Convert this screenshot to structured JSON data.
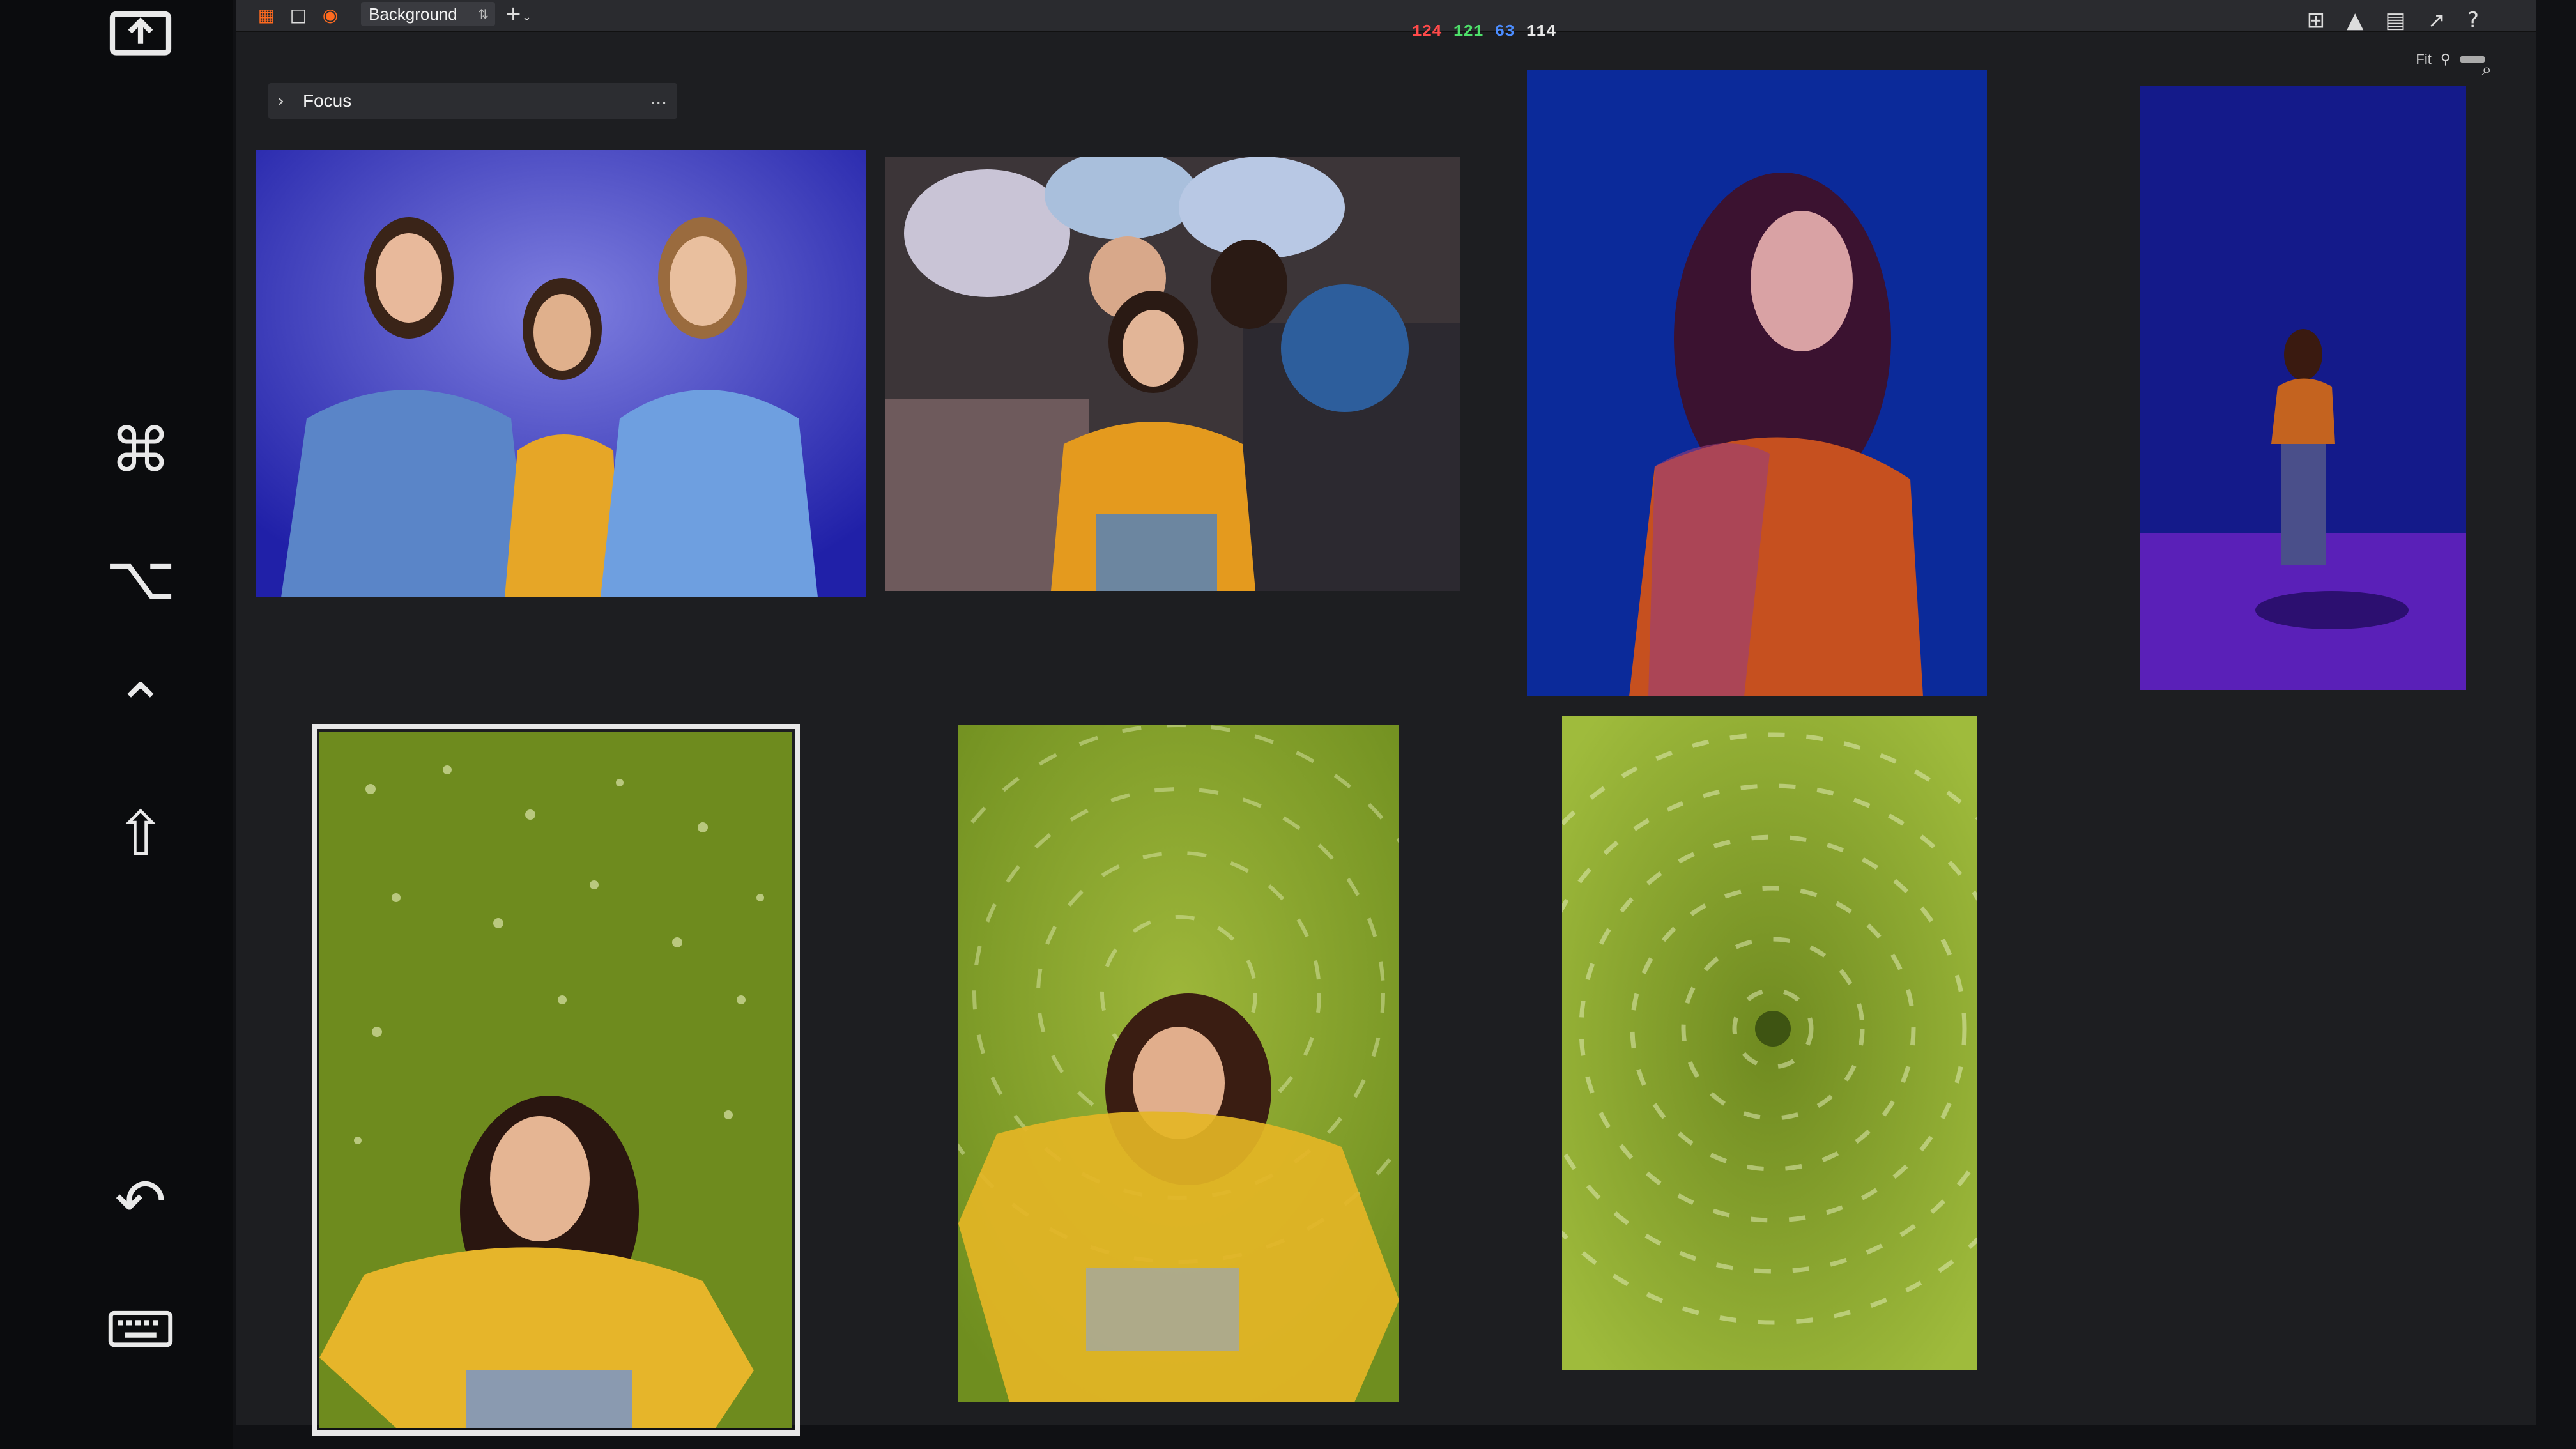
{
  "app": {
    "layer_name": "Background",
    "add_symbol": "+",
    "color_readout": {
      "r": "124",
      "g": "121",
      "b": "63",
      "a": "114"
    },
    "fit_label": "Fit",
    "panel": {
      "title": "Focus",
      "more": "..."
    }
  },
  "sidebar_keys": [
    {
      "name": "command"
    },
    {
      "name": "option"
    },
    {
      "name": "control"
    },
    {
      "name": "shift"
    },
    {
      "name": "undo"
    },
    {
      "name": "keyboard"
    }
  ],
  "thumbnails": [
    {
      "subject": "three-women-blue-backdrop",
      "selected": false
    },
    {
      "subject": "four-women-lying-on-blankets",
      "selected": false
    },
    {
      "subject": "woman-orange-sweater-blue-light",
      "selected": false
    },
    {
      "subject": "woman-standing-purple-stage",
      "selected": false
    },
    {
      "subject": "woman-yellow-sweater-on-grass",
      "selected": true
    },
    {
      "subject": "woman-yellow-sweater-spin-blur",
      "selected": false
    },
    {
      "subject": "grass-radial-spin-blur",
      "selected": false
    }
  ],
  "colors": {
    "accent": "#ff6a1f",
    "background": "#1d1e21",
    "toolbar": "#2a2b2f"
  }
}
